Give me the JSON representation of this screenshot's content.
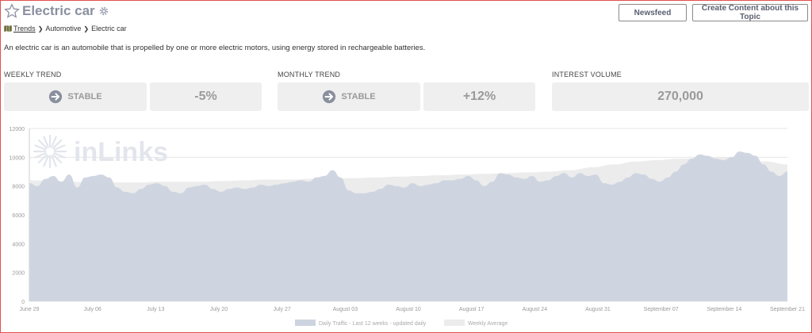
{
  "header": {
    "title": "Electric car",
    "newsfeed_label": "Newsfeed",
    "create_label": "Create Content about this Topic"
  },
  "breadcrumb": {
    "root": "Trends",
    "items": [
      "Automotive",
      "Electric car"
    ]
  },
  "description": "An electric car is an automobile that is propelled by one or more electric motors, using energy stored in rechargeable batteries.",
  "stats": {
    "weekly": {
      "label": "WEEKLY TREND",
      "status": "STABLE",
      "change": "-5%"
    },
    "monthly": {
      "label": "MONTHLY TREND",
      "status": "STABLE",
      "change": "+12%"
    },
    "volume": {
      "label": "INTEREST VOLUME",
      "value": "270,000"
    }
  },
  "watermark": "inLinks",
  "colors": {
    "daily": "#cdd4df",
    "weekly": "#ececec",
    "title": "#8a8fa0"
  },
  "chart_data": {
    "type": "area",
    "x_labels": [
      "June 29",
      "July 06",
      "July 13",
      "July 20",
      "July 27",
      "August 03",
      "August 10",
      "August 17",
      "August 24",
      "August 31",
      "September 07",
      "September 14",
      "September 21"
    ],
    "ylim": [
      0,
      12000
    ],
    "yticks": [
      0,
      2000,
      4000,
      6000,
      8000,
      10000,
      12000
    ],
    "grid": true,
    "legend_position": "bottom",
    "series": [
      {
        "name": "Daily Traffic - Last 12 weeks - updated daily",
        "values": [
          8200,
          8000,
          8500,
          8700,
          8300,
          8800,
          7900,
          8600,
          8700,
          8800,
          8600,
          7900,
          7600,
          7500,
          7800,
          8100,
          8200,
          8000,
          7600,
          7500,
          7900,
          8000,
          8100,
          7800,
          7600,
          7800,
          7900,
          7800,
          7900,
          8100,
          8000,
          8100,
          8200,
          8300,
          8400,
          8300,
          8600,
          8700,
          9100,
          8600,
          7700,
          7500,
          7500,
          7600,
          7800,
          8100,
          8000,
          7900,
          8200,
          8000,
          8100,
          8200,
          8400,
          8400,
          8500,
          8700,
          8400,
          8000,
          8300,
          8900,
          8800,
          8600,
          8500,
          8700,
          8300,
          8400,
          8700,
          8900,
          8600,
          8900,
          8700,
          8800,
          8200,
          8100,
          8300,
          8600,
          8900,
          8800,
          8500,
          8300,
          8600,
          9000,
          9500,
          9900,
          10200,
          10100,
          9900,
          9800,
          10000,
          10400,
          10300,
          10100,
          9500,
          9000,
          8700,
          9000
        ]
      },
      {
        "name": "Weekly Average",
        "values": [
          8400,
          8350,
          8300,
          8250,
          8250,
          8250,
          8300,
          8300,
          8300,
          8350,
          8400,
          8450,
          8450,
          8500,
          8500,
          8550,
          8600,
          8650,
          8700,
          8750,
          8800,
          8850,
          8900,
          8950,
          9000,
          9100,
          9300,
          9500,
          9700,
          9800,
          9900,
          9950,
          10000,
          9900,
          9700,
          9500
        ]
      }
    ]
  }
}
